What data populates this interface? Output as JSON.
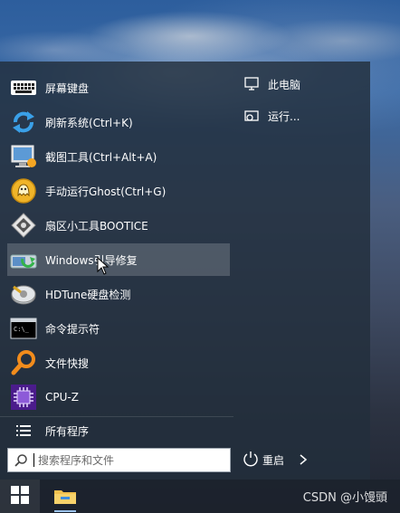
{
  "start_menu": {
    "items": [
      {
        "label": "屏幕键盘",
        "icon": "keyboard-icon"
      },
      {
        "label": "刷新系统(Ctrl+K)",
        "icon": "refresh-icon"
      },
      {
        "label": "截图工具(Ctrl+Alt+A)",
        "icon": "screenshot-icon"
      },
      {
        "label": "手动运行Ghost(Ctrl+G)",
        "icon": "ghost-icon"
      },
      {
        "label": "扇区小工具BOOTICE",
        "icon": "bootice-icon"
      },
      {
        "label": "Windows引导修复",
        "icon": "boot-repair-icon"
      },
      {
        "label": "HDTune硬盘检测",
        "icon": "hdtune-icon"
      },
      {
        "label": "命令提示符",
        "icon": "cmd-icon"
      },
      {
        "label": "文件快搜",
        "icon": "file-search-icon"
      },
      {
        "label": "CPU-Z",
        "icon": "cpuz-icon"
      }
    ],
    "all_programs_label": "所有程序",
    "search_placeholder": "搜索程序和文件",
    "right": {
      "this_pc": "此电脑",
      "run": "运行..."
    },
    "power": {
      "label": "重启"
    }
  },
  "watermark": "CSDN @小馒頭",
  "colors": {
    "menu_bg": "#222e3c",
    "highlight": "rgba(255,255,255,0.18)",
    "taskbar": "#1c222c"
  }
}
